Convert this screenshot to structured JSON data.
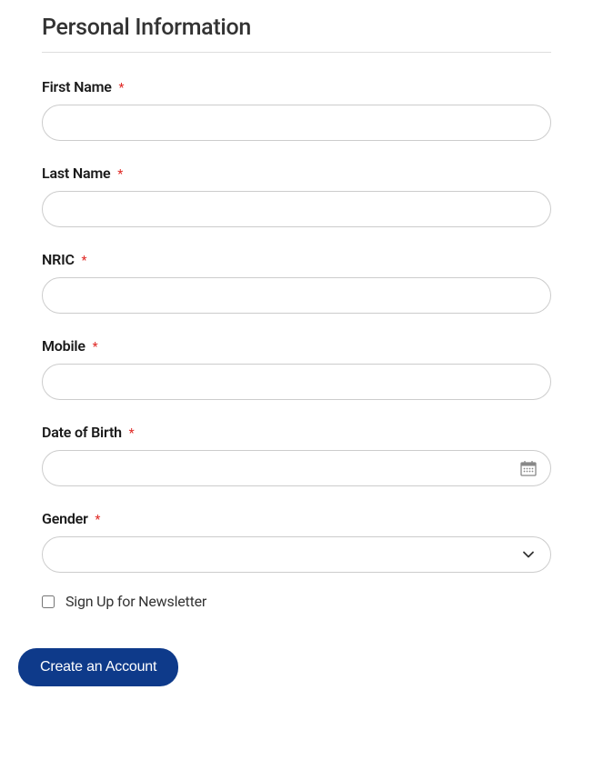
{
  "section": {
    "title": "Personal Information"
  },
  "fields": {
    "firstName": {
      "label": "First Name",
      "required": "*",
      "value": ""
    },
    "lastName": {
      "label": "Last Name",
      "required": "*",
      "value": ""
    },
    "nric": {
      "label": "NRIC",
      "required": "*",
      "value": ""
    },
    "mobile": {
      "label": "Mobile",
      "required": "*",
      "value": ""
    },
    "dob": {
      "label": "Date of Birth",
      "required": "*",
      "value": ""
    },
    "gender": {
      "label": "Gender",
      "required": "*",
      "value": ""
    },
    "newsletter": {
      "label": "Sign Up for Newsletter",
      "checked": false
    }
  },
  "actions": {
    "submit": "Create an Account"
  },
  "colors": {
    "primary": "#0e3a8a",
    "required": "#e02b27"
  }
}
